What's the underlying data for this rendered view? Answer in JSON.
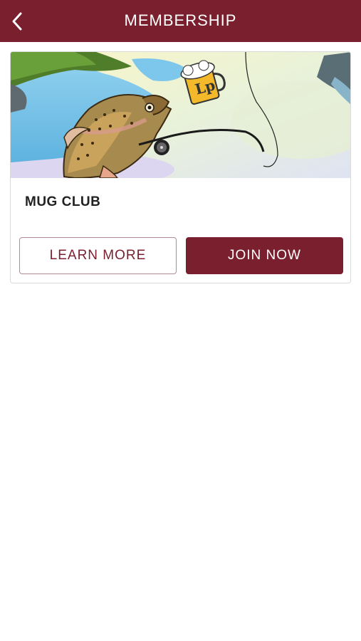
{
  "header": {
    "title": "MEMBERSHIP",
    "back_icon": "chevron-left-icon"
  },
  "membership_card": {
    "title": "MUG CLUB",
    "image": "trout-catching-beer-mug-illustration",
    "mug_logo_text": "Lp",
    "learn_more_label": "LEARN MORE",
    "join_now_label": "JOIN NOW"
  },
  "colors": {
    "brand": "#7a1f2e",
    "outline": "#b58a92",
    "card_border": "#d9d9d9"
  }
}
